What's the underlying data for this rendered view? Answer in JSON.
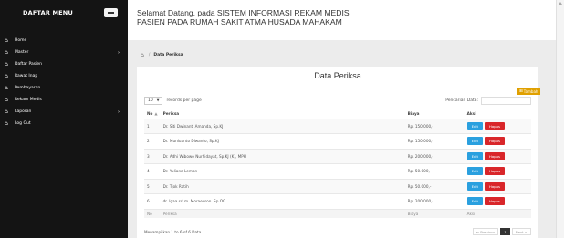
{
  "sidebar": {
    "title": "DAFTAR MENU",
    "items": [
      {
        "label": "Home",
        "icon": "home-icon",
        "has_submenu": false
      },
      {
        "label": "Master",
        "icon": "home-icon",
        "has_submenu": true
      },
      {
        "label": "Daftar Pasien",
        "icon": "home-icon",
        "has_submenu": false
      },
      {
        "label": "Rawat Inap",
        "icon": "home-icon",
        "has_submenu": false
      },
      {
        "label": "Pembayaran",
        "icon": "home-icon",
        "has_submenu": false
      },
      {
        "label": "Rekam Medis",
        "icon": "home-icon",
        "has_submenu": false
      },
      {
        "label": "Laporan",
        "icon": "home-icon",
        "has_submenu": true
      },
      {
        "label": "Log Out",
        "icon": "home-icon",
        "has_submenu": false
      }
    ]
  },
  "header": {
    "app_title": "Selamat Datang, pada SISTEM INFORMASI REKAM MEDIS PASIEN PADA RUMAH SAKIT ATMA HUSADA MAHAKAM"
  },
  "breadcrumb": {
    "sep": "/",
    "current": "Data Periksa"
  },
  "panel": {
    "title": "Data Periksa",
    "add_label": "Tambah",
    "length_value": "10",
    "length_suffix": "records per page",
    "search_label": "Pencarian Data:",
    "columns": {
      "no": "No",
      "periksa": "Periksa",
      "biaya": "Biaya",
      "aksi": "Aksi"
    },
    "edit_label": "Edit",
    "delete_label": "Hapus",
    "rows": [
      {
        "no": "1",
        "periksa": "Dr. Siti Dwinanti Amanda, Sp.KJ",
        "biaya": "Rp. 150.000,-"
      },
      {
        "no": "2",
        "periksa": "Dr. Muniuanto Diwanto, Sp.KJ",
        "biaya": "Rp. 150.000,-"
      },
      {
        "no": "3",
        "periksa": "Dr. Adhi Wibowo Nurhidayat, Sp.KJ (K), MPH",
        "biaya": "Rp. 200.000,-"
      },
      {
        "no": "4",
        "periksa": "Dr. Yuliana Leman",
        "biaya": "Rp. 50.000,-"
      },
      {
        "no": "5",
        "periksa": "Dr. Tjok Ratih",
        "biaya": "Rp. 50.000,-"
      },
      {
        "no": "6",
        "periksa": "dr. Igaa sri m. Moraesson. Sp.OG",
        "biaya": "Rp. 200.000,-"
      }
    ],
    "info": "Menampilkan 1 to 6 of 6 Data",
    "prev": "← Previous",
    "page": "1",
    "next": "Next →"
  },
  "colors": {
    "sidebar_bg": "#141414",
    "edit_button": "#2aa0df",
    "delete_button": "#d9262a",
    "add_button": "#e0a000"
  }
}
